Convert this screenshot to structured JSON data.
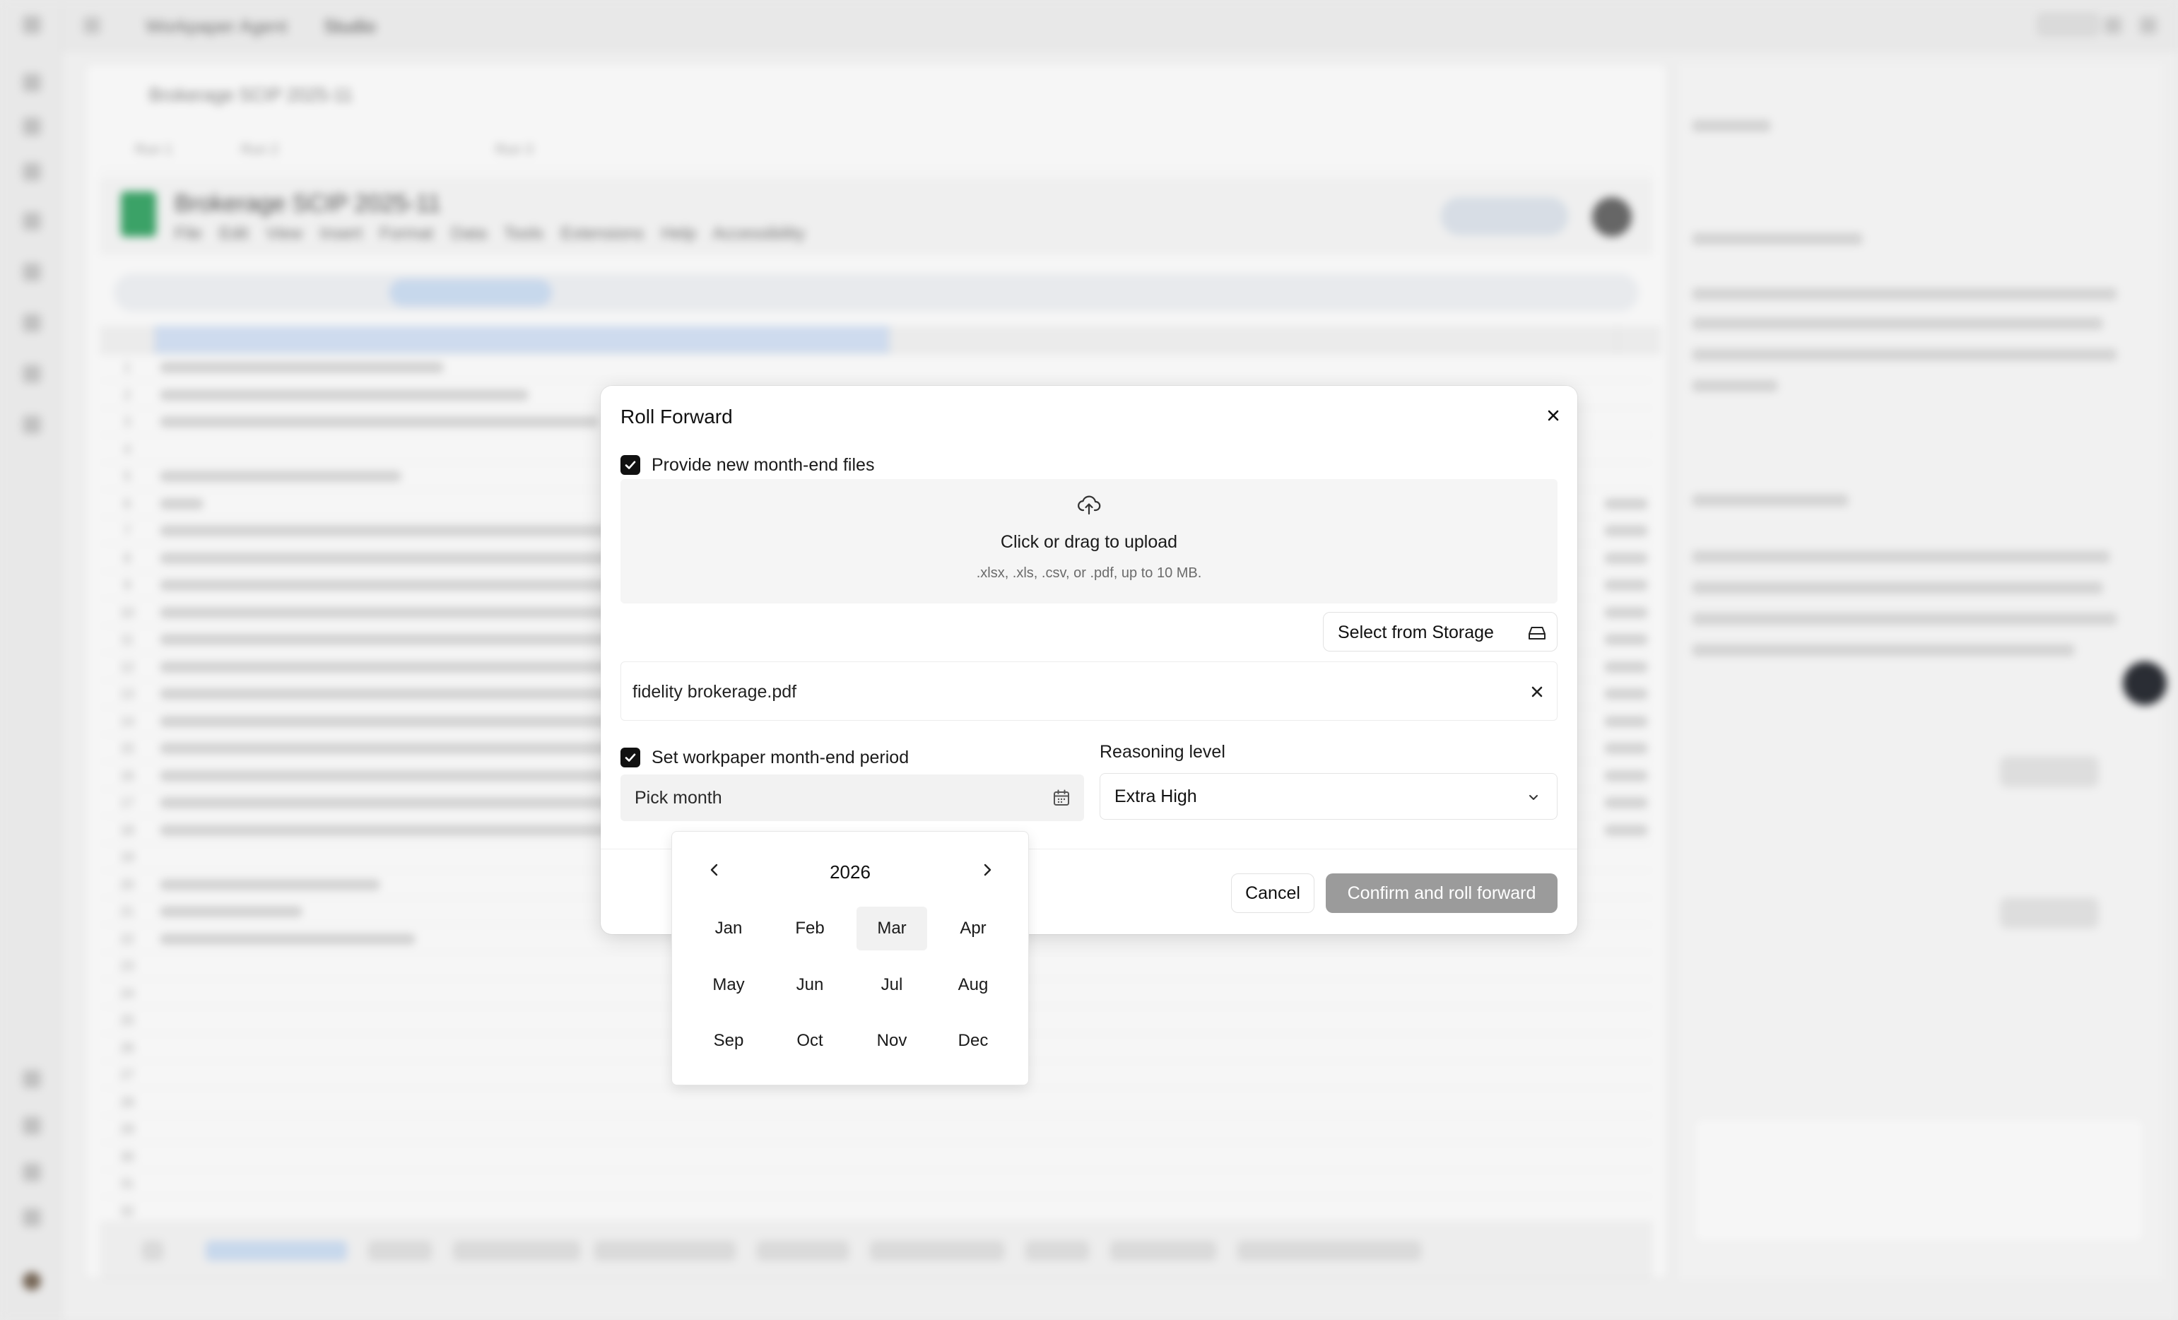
{
  "background": {
    "breadcrumb": [
      "Workpaper Agent",
      "Studio"
    ],
    "workpaper_title": "Brokerage SCIP 2025-11",
    "menu": "File Edit View Insert Format Data Tools Extensions Help Accessibility"
  },
  "modal": {
    "title": "Roll Forward",
    "provide_files_label": "Provide new month-end files",
    "provide_files_checked": true,
    "upload_main": "Click or drag to upload",
    "upload_sub": ".xlsx, .xls, .csv, or .pdf, up to 10 MB.",
    "storage_button": "Select from Storage",
    "file_name": "fidelity brokerage.pdf",
    "set_period_label": "Set workpaper month-end period",
    "set_period_checked": true,
    "month_placeholder": "Pick month",
    "reasoning_label": "Reasoning level",
    "reasoning_value": "Extra High",
    "cancel": "Cancel",
    "confirm": "Confirm and roll forward"
  },
  "picker": {
    "year": "2026",
    "months": [
      "Jan",
      "Feb",
      "Mar",
      "Apr",
      "May",
      "Jun",
      "Jul",
      "Aug",
      "Sep",
      "Oct",
      "Nov",
      "Dec"
    ],
    "highlighted": "Mar"
  },
  "colors": {
    "primary_disabled": "#9b9b9b",
    "checkbox": "#111111",
    "accent_green": "#3ea86b"
  }
}
